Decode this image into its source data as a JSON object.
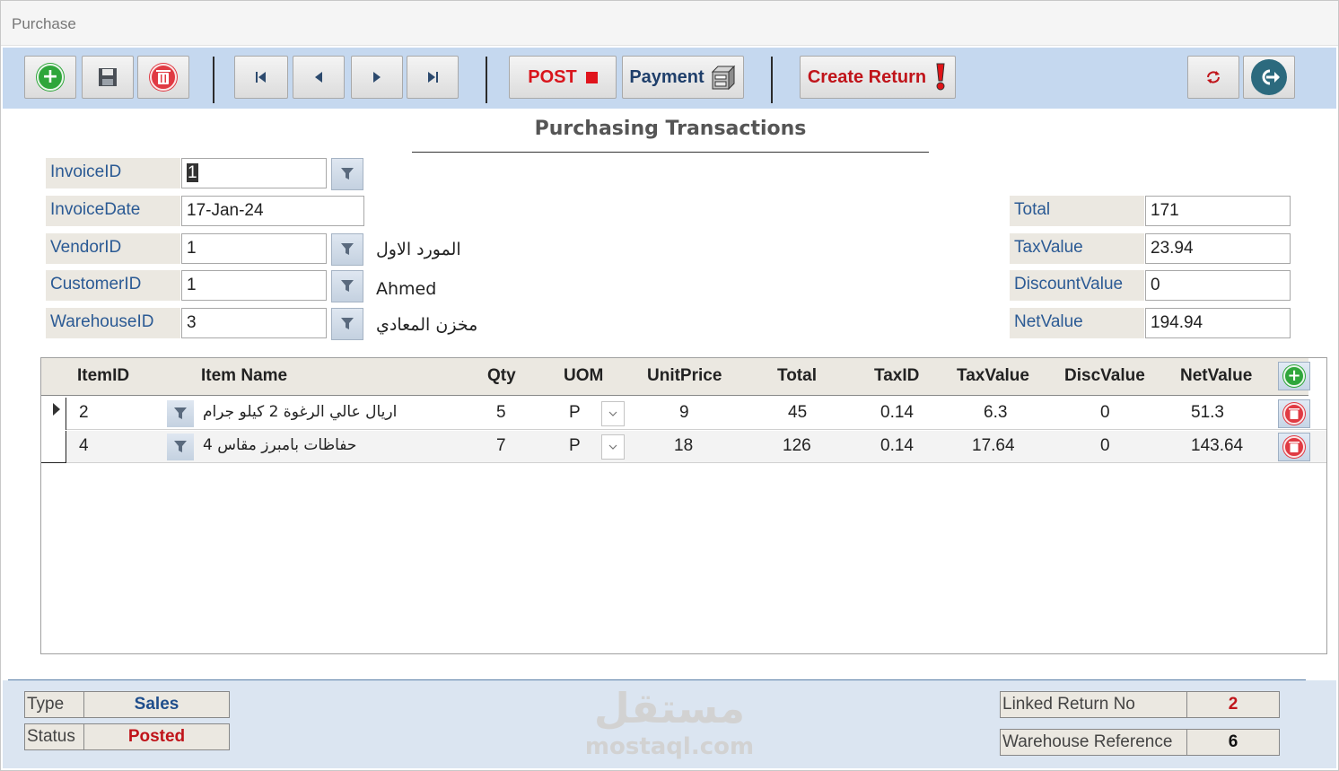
{
  "window": {
    "title": "Purchase"
  },
  "toolbar": {
    "post_label": "POST",
    "payment_label": "Payment",
    "create_return_label": "Create Return"
  },
  "form": {
    "title": "Purchasing Transactions",
    "fields": {
      "invoice_id": {
        "label": "InvoiceID",
        "value": "1"
      },
      "invoice_date": {
        "label": "InvoiceDate",
        "value": "17-Jan-24"
      },
      "vendor_id": {
        "label": "VendorID",
        "value": "1",
        "name": "المورد الاول"
      },
      "customer_id": {
        "label": "CustomerID",
        "value": "1",
        "name": "Ahmed"
      },
      "warehouse_id": {
        "label": "WarehouseID",
        "value": "3",
        "name": "مخزن المعادي"
      }
    },
    "totals": {
      "total": {
        "label": "Total",
        "value": "171"
      },
      "tax_value": {
        "label": "TaxValue",
        "value": "23.94"
      },
      "discount_value": {
        "label": "DiscountValue",
        "value": "0"
      },
      "net_value": {
        "label": "NetValue",
        "value": "194.94"
      }
    }
  },
  "grid": {
    "columns": {
      "item_id": "ItemID",
      "item_name": "Item Name",
      "qty": "Qty",
      "uom": "UOM",
      "unit_price": "UnitPrice",
      "total": "Total",
      "tax_id": "TaxID",
      "tax_value": "TaxValue",
      "disc_value": "DiscValue",
      "net_value": "NetValue"
    },
    "rows": [
      {
        "item_id": "2",
        "item_name": "اريال عالي الرغوة 2 كيلو جرام",
        "qty": "5",
        "uom": "P",
        "unit_price": "9",
        "total": "45",
        "tax_id": "0.14",
        "tax_value": "6.3",
        "disc_value": "0",
        "net_value": "51.3"
      },
      {
        "item_id": "4",
        "item_name": "حفاظات بامبرز مقاس 4",
        "qty": "7",
        "uom": "P",
        "unit_price": "18",
        "total": "126",
        "tax_id": "0.14",
        "tax_value": "17.64",
        "disc_value": "0",
        "net_value": "143.64"
      }
    ]
  },
  "footer": {
    "type_label": "Type",
    "type_value": "Sales",
    "status_label": "Status",
    "status_value": "Posted",
    "linked_return_label": "Linked Return No",
    "linked_return_value": "2",
    "warehouse_ref_label": "Warehouse Reference",
    "warehouse_ref_value": "6"
  },
  "watermark": {
    "arabic": "مستقل",
    "latin": "mostaql.com"
  },
  "colors": {
    "toolbar_bg": "#c5d8ef",
    "label_bg": "#ebe8e1",
    "label_text": "#2b5a94",
    "post_red": "#d9151c",
    "status_red": "#c0141a",
    "sales_blue": "#1f4e8c"
  }
}
